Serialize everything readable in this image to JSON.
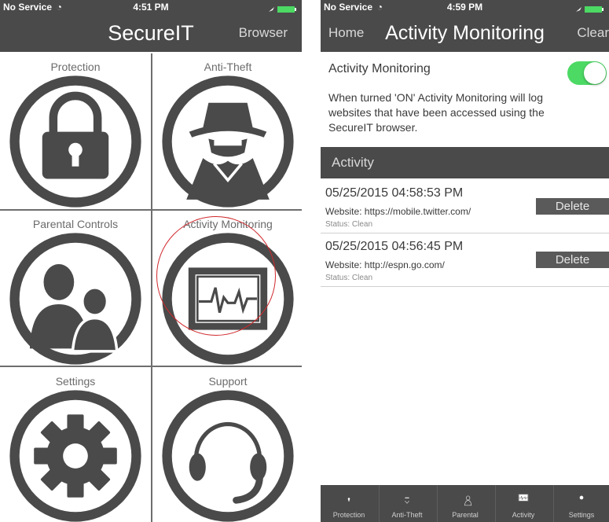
{
  "left_screen": {
    "status": {
      "carrier": "No Service  ◔",
      "time": "4:51 PM"
    },
    "title": "SecureIT",
    "browser_link": "Browser",
    "tiles": [
      {
        "label": "Protection",
        "icon": "lock-icon"
      },
      {
        "label": "Anti-Theft",
        "icon": "spy-icon"
      },
      {
        "label": "Parental Controls",
        "icon": "parental-icon"
      },
      {
        "label": "Activity Monitoring",
        "icon": "activity-monitor-icon",
        "highlighted": true
      },
      {
        "label": "Settings",
        "icon": "gear-icon"
      },
      {
        "label": "Support",
        "icon": "headset-icon"
      }
    ]
  },
  "right_screen": {
    "status": {
      "carrier": "No Service  ◔",
      "time": "4:59 PM"
    },
    "home_link": "Home",
    "title": "Activity Monitoring",
    "clear_link": "Clear",
    "setting_label": "Activity Monitoring",
    "toggle_on": true,
    "description": "When turned 'ON' Activity Monitoring will log websites that have been accessed using the SecureIT browser.",
    "section_header": "Activity",
    "activities": [
      {
        "date": "05/25/2015 04:58:53 PM",
        "website": "Website: https://mobile.twitter.com/",
        "status": "Status: Clean",
        "delete_label": "Delete"
      },
      {
        "date": "05/25/2015 04:56:45 PM",
        "website": "Website: http://espn.go.com/",
        "status": "Status: Clean",
        "delete_label": "Delete"
      }
    ],
    "tabs": [
      {
        "label": "Protection",
        "icon": "lock-icon"
      },
      {
        "label": "Anti-Theft",
        "icon": "spy-icon"
      },
      {
        "label": "Parental",
        "icon": "parental-icon"
      },
      {
        "label": "Activity",
        "icon": "activity-monitor-icon"
      },
      {
        "label": "Settings",
        "icon": "gear-icon"
      }
    ]
  },
  "colors": {
    "bar": "#4a4a4a",
    "icon": "#4a4a4a",
    "toggle_on": "#4cd964",
    "highlight": "#d0282c",
    "battery": "#4cd964"
  }
}
